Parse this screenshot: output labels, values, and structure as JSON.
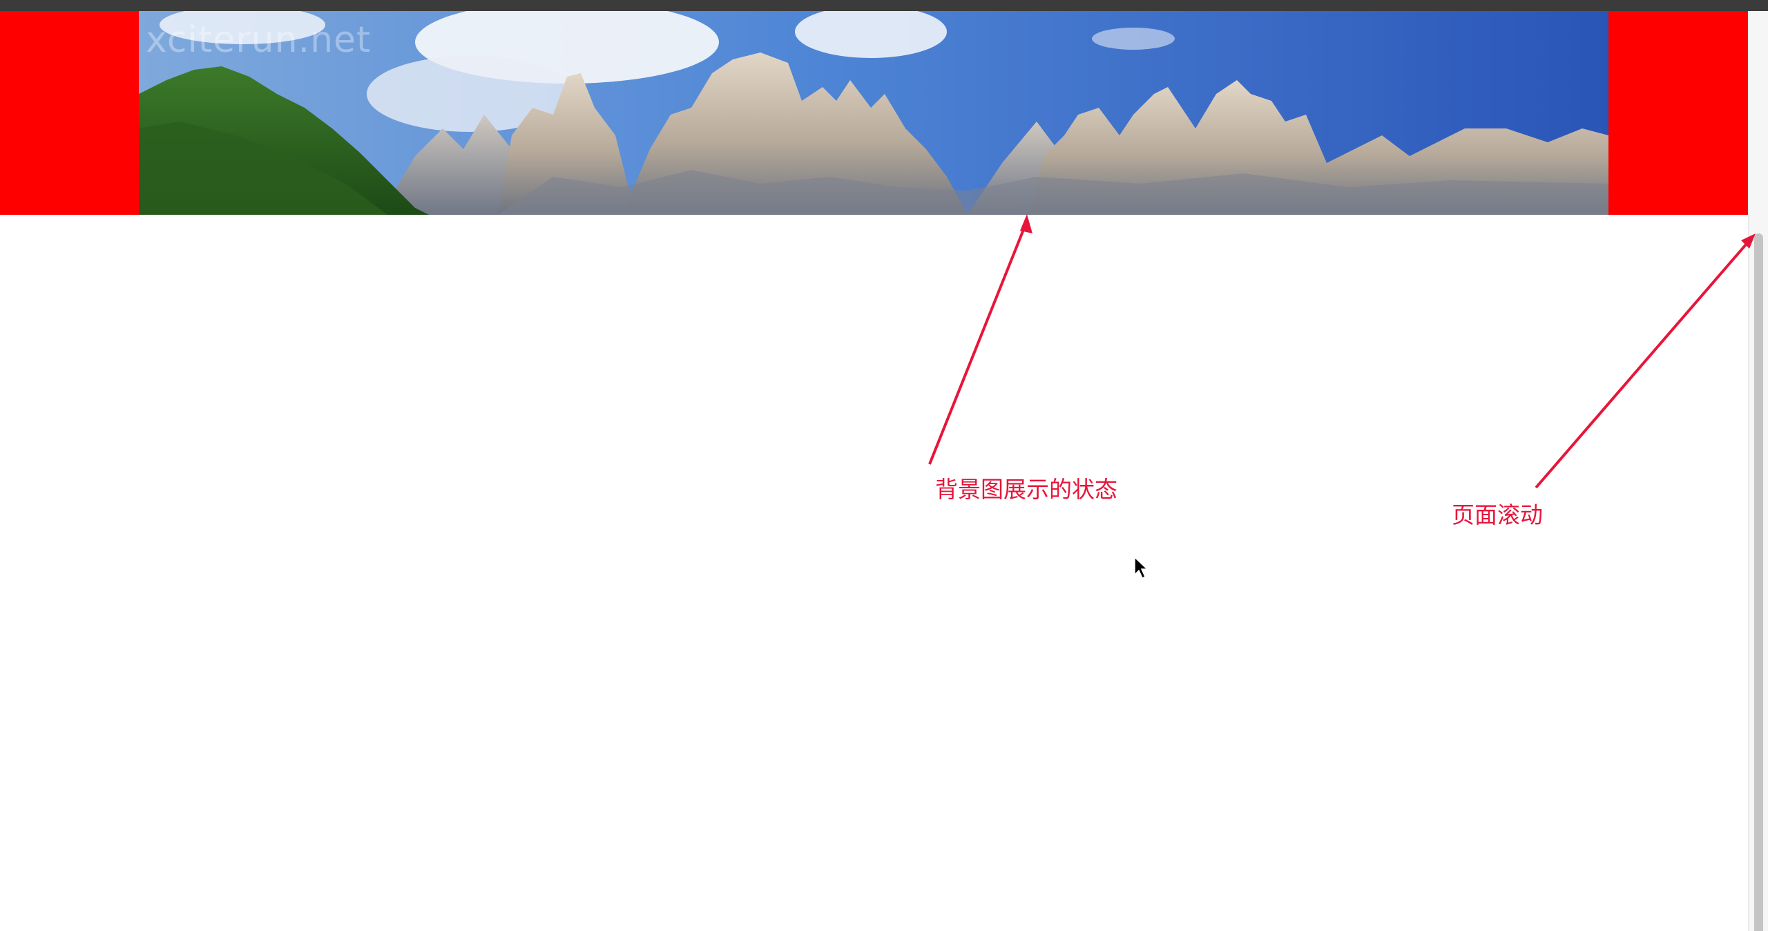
{
  "banner": {
    "watermark": "xciterun.net",
    "side_color": "#ff0000",
    "image": "mountain-landscape"
  },
  "annotations": {
    "background_state": "背景图展示的状态",
    "page_scroll": "页面滚动",
    "color": "#e8153a"
  },
  "scrollbar": {
    "thumb_color": "#c4c4c4"
  }
}
